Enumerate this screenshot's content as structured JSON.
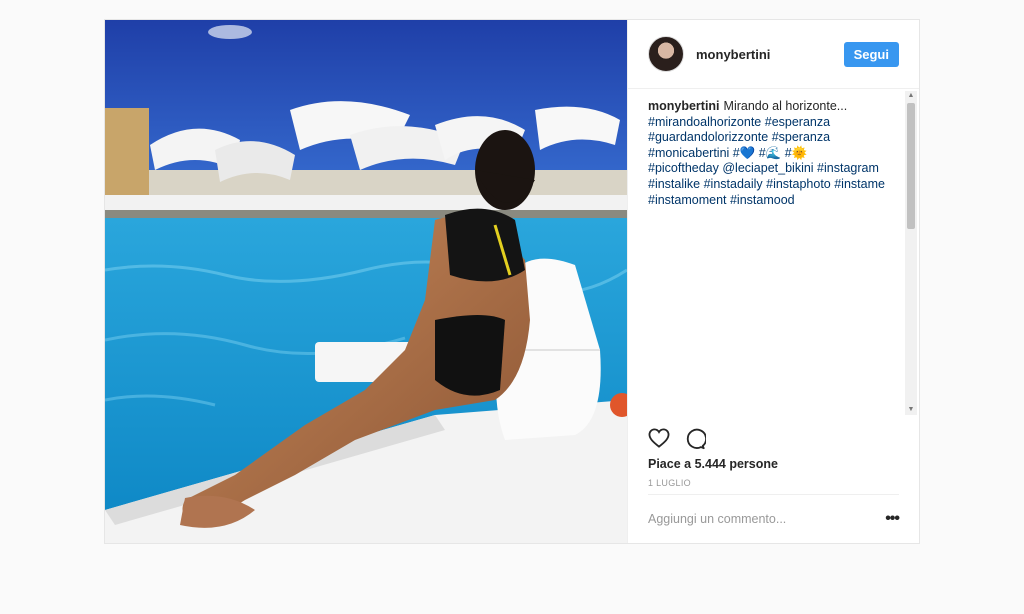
{
  "post": {
    "username": "monybertini",
    "follow_label": "Segui",
    "caption_author": "monybertini",
    "caption_text": "Mirando al horizonte...",
    "caption_lines": [
      "#mirandoalhorizonte #esperanza",
      "#guardandolorizzonte #speranza",
      "#monicabertini #💙 #🌊 #🌞",
      "#picoftheday @leciapet_bikini #instagram",
      "#instalike #instadaily #instaphoto #instame",
      "#instamoment #instamood"
    ],
    "likes_text": "Piace a 5.444 persone",
    "date_text": "1 luglio",
    "comment_placeholder": "Aggiungi un commento...",
    "more_label": "•••"
  },
  "icons": {
    "like": "heart-icon",
    "comment": "comment-bubble-icon",
    "options": "more-options-icon"
  },
  "colors": {
    "accent": "#3897f0",
    "hashtag": "#003569",
    "muted": "#999999"
  }
}
